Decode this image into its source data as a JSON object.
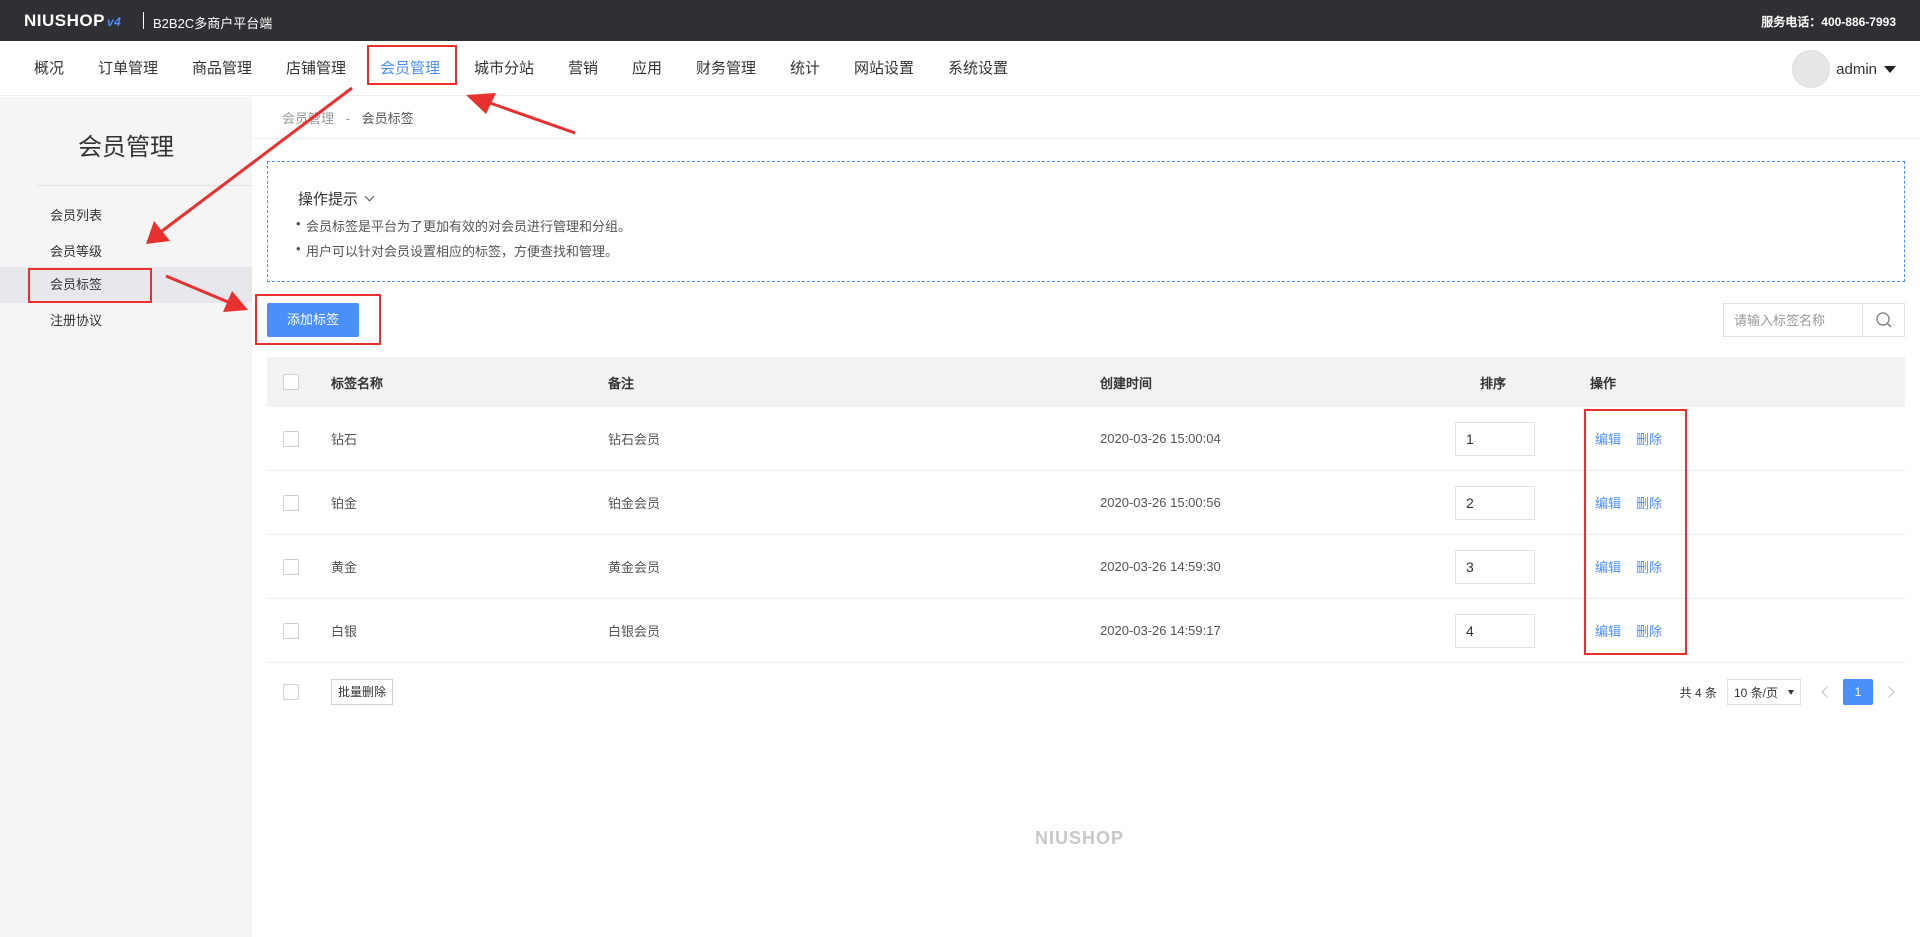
{
  "topbar": {
    "logo": "NIUSHOP",
    "logo_version": "v4",
    "subtitle": "B2B2C多商户平台端",
    "service": "服务电话：400-886-7993"
  },
  "nav": {
    "items": [
      {
        "label": "概况"
      },
      {
        "label": "订单管理"
      },
      {
        "label": "商品管理"
      },
      {
        "label": "店铺管理"
      },
      {
        "label": "会员管理"
      },
      {
        "label": "城市分站"
      },
      {
        "label": "营销"
      },
      {
        "label": "应用"
      },
      {
        "label": "财务管理"
      },
      {
        "label": "统计"
      },
      {
        "label": "网站设置"
      },
      {
        "label": "系统设置"
      }
    ],
    "active": "会员管理",
    "user": "admin"
  },
  "sidebar": {
    "title": "会员管理",
    "items": [
      {
        "label": "会员列表"
      },
      {
        "label": "会员等级"
      },
      {
        "label": "会员标签"
      },
      {
        "label": "注册协议"
      }
    ],
    "active": "会员标签"
  },
  "breadcrumb": {
    "parent": "会员管理",
    "sep": "-",
    "current": "会员标签"
  },
  "tips": {
    "title": "操作提示",
    "items": [
      "会员标签是平台为了更加有效的对会员进行管理和分组。",
      "用户可以针对会员设置相应的标签，方便查找和管理。"
    ]
  },
  "toolbar": {
    "add_label": "添加标签",
    "search_placeholder": "请输入标签名称"
  },
  "table": {
    "headers": {
      "name": "标签名称",
      "remark": "备注",
      "created": "创建时间",
      "sort": "排序",
      "ops": "操作"
    },
    "rows": [
      {
        "name": "钻石",
        "remark": "钻石会员",
        "created": "2020-03-26 15:00:04",
        "sort": "1"
      },
      {
        "name": "铂金",
        "remark": "铂金会员",
        "created": "2020-03-26 15:00:56",
        "sort": "2"
      },
      {
        "name": "黄金",
        "remark": "黄金会员",
        "created": "2020-03-26 14:59:30",
        "sort": "3"
      },
      {
        "name": "白银",
        "remark": "白银会员",
        "created": "2020-03-26 14:59:17",
        "sort": "4"
      }
    ],
    "edit_label": "编辑",
    "delete_label": "删除"
  },
  "footer": {
    "batch_delete": "批量删除",
    "total": "共 4 条",
    "page_size": "10 条/页",
    "current_page": "1"
  },
  "brand_footer": "NIUSHOP",
  "colors": {
    "accent": "#4a8ffc",
    "annotation": "#e8312f",
    "topbar": "#2f3033"
  }
}
